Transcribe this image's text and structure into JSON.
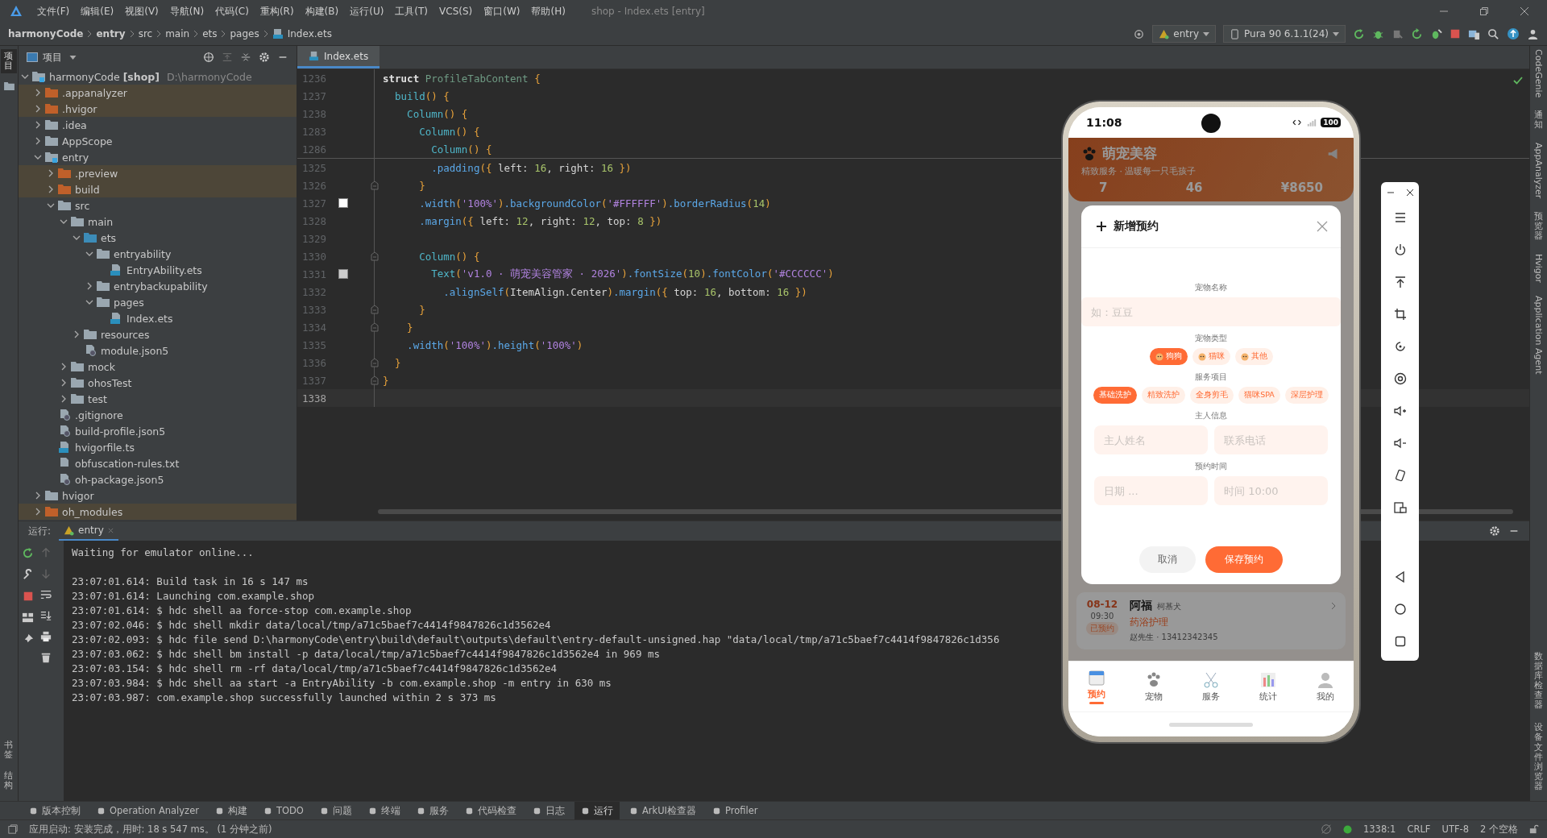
{
  "window": {
    "title": "shop - Index.ets [entry]",
    "menu": [
      "文件(F)",
      "编辑(E)",
      "视图(V)",
      "导航(N)",
      "代码(C)",
      "重构(R)",
      "构建(B)",
      "运行(U)",
      "工具(T)",
      "VCS(S)",
      "窗口(W)",
      "帮助(H)"
    ]
  },
  "breadcrumb": [
    {
      "label": "harmonyCode",
      "bold": true,
      "kind": "folder"
    },
    {
      "label": "entry",
      "bold": true,
      "kind": "folder"
    },
    {
      "label": "src",
      "bold": false,
      "kind": "folder"
    },
    {
      "label": "main",
      "bold": false,
      "kind": "folder"
    },
    {
      "label": "ets",
      "bold": false,
      "kind": "folder"
    },
    {
      "label": "pages",
      "bold": false,
      "kind": "folder"
    },
    {
      "label": "Index.ets",
      "bold": false,
      "kind": "file"
    }
  ],
  "toolbar": {
    "run_config": "entry",
    "device": "Pura 90 6.1.1(24)"
  },
  "left_strip": {
    "top": [
      {
        "label": "项目",
        "selected": true
      }
    ],
    "bottom": [
      {
        "label": "书签",
        "selected": false
      },
      {
        "label": "结构",
        "selected": false
      }
    ]
  },
  "right_strip": {
    "top": [
      {
        "label": "CodeGenie",
        "kind": "latin"
      },
      {
        "label": "通知",
        "kind": "cjk"
      },
      {
        "label": "AppAnalyzer",
        "kind": "latin"
      },
      {
        "label": "预览器",
        "kind": "cjk"
      },
      {
        "label": "Hvigor",
        "kind": "latin"
      },
      {
        "label": "Application Agent",
        "kind": "latin"
      }
    ],
    "bottom": [
      {
        "label": "数据库检查器",
        "kind": "cjk"
      },
      {
        "label": "设备文件浏览器",
        "kind": "cjk"
      }
    ]
  },
  "project_panel": {
    "title": "项目",
    "tree": [
      {
        "label": "harmonyCode **[shop]**",
        "path": "D:\\harmonyCode",
        "kind": "module",
        "expanded": true,
        "excluded": false,
        "children": [
          {
            "label": ".appanalyzer",
            "kind": "folder",
            "expanded": false,
            "excluded": true
          },
          {
            "label": ".hvigor",
            "kind": "folder",
            "expanded": false,
            "excluded": true
          },
          {
            "label": ".idea",
            "kind": "folder",
            "expanded": false,
            "excluded": false
          },
          {
            "label": "AppScope",
            "kind": "folder",
            "expanded": false,
            "excluded": false
          },
          {
            "label": "entry",
            "kind": "module",
            "expanded": true,
            "excluded": false,
            "children": [
              {
                "label": ".preview",
                "kind": "folder",
                "expanded": false,
                "excluded": true
              },
              {
                "label": "build",
                "kind": "folder",
                "expanded": false,
                "excluded": true
              },
              {
                "label": "src",
                "kind": "folder",
                "expanded": true,
                "excluded": false,
                "children": [
                  {
                    "label": "main",
                    "kind": "folder",
                    "expanded": true,
                    "excluded": false,
                    "children": [
                      {
                        "label": "ets",
                        "kind": "source",
                        "expanded": true,
                        "excluded": false,
                        "children": [
                          {
                            "label": "entryability",
                            "kind": "folder",
                            "expanded": true,
                            "excluded": false,
                            "children": [
                              {
                                "label": "EntryAbility.ets",
                                "kind": "ets",
                                "excluded": false
                              }
                            ]
                          },
                          {
                            "label": "entrybackupability",
                            "kind": "folder",
                            "expanded": false,
                            "excluded": false
                          },
                          {
                            "label": "pages",
                            "kind": "folder",
                            "expanded": true,
                            "excluded": false,
                            "children": [
                              {
                                "label": "Index.ets",
                                "kind": "ets",
                                "excluded": false
                              }
                            ]
                          }
                        ]
                      },
                      {
                        "label": "resources",
                        "kind": "folder",
                        "expanded": false,
                        "excluded": false
                      },
                      {
                        "label": "module.json5",
                        "kind": "json",
                        "excluded": false
                      }
                    ]
                  },
                  {
                    "label": "mock",
                    "kind": "folder",
                    "expanded": false,
                    "excluded": false
                  },
                  {
                    "label": "ohosTest",
                    "kind": "folder",
                    "expanded": false,
                    "excluded": false
                  },
                  {
                    "label": "test",
                    "kind": "folder",
                    "expanded": false,
                    "excluded": false
                  }
                ]
              },
              {
                "label": ".gitignore",
                "kind": "git",
                "excluded": false
              },
              {
                "label": "build-profile.json5",
                "kind": "json",
                "excluded": false
              },
              {
                "label": "hvigorfile.ts",
                "kind": "ts",
                "excluded": false
              },
              {
                "label": "obfuscation-rules.txt",
                "kind": "txt",
                "excluded": false
              },
              {
                "label": "oh-package.json5",
                "kind": "json",
                "excluded": false
              }
            ]
          },
          {
            "label": "hvigor",
            "kind": "folder",
            "expanded": false,
            "excluded": false
          },
          {
            "label": "oh_modules",
            "kind": "folder",
            "expanded": false,
            "excluded": true
          }
        ]
      }
    ]
  },
  "editor": {
    "tabs": [
      {
        "label": "Index.ets",
        "selected": true
      }
    ],
    "sticky_lines": [
      {
        "number": "1236",
        "tokens": [
          {
            "t": "struct ",
            "kind": "kw"
          },
          {
            "t": "ProfileTabContent ",
            "kind": "type"
          },
          {
            "t": "{",
            "kind": "p"
          }
        ]
      },
      {
        "number": "1237",
        "tokens": [
          {
            "t": "  build",
            "kind": "fn"
          },
          {
            "t": "() {",
            "kind": "p"
          }
        ]
      },
      {
        "number": "1238",
        "tokens": [
          {
            "t": "    Column",
            "kind": "fn"
          },
          {
            "t": "() {",
            "kind": "p"
          }
        ]
      },
      {
        "number": "1283",
        "tokens": [
          {
            "t": "      Column",
            "kind": "fn"
          },
          {
            "t": "() {",
            "kind": "p"
          }
        ]
      },
      {
        "number": "1286",
        "tokens": [
          {
            "t": "        Column",
            "kind": "fn"
          },
          {
            "t": "() {",
            "kind": "p"
          }
        ]
      }
    ],
    "lines": [
      {
        "number": "1325",
        "fold": false,
        "current": false,
        "tokens": [
          {
            "t": "        .padding",
            "kind": "m"
          },
          {
            "t": "({ ",
            "kind": "p"
          },
          {
            "t": "left: ",
            "kind": "x"
          },
          {
            "t": "16",
            "kind": "n"
          },
          {
            "t": ", ",
            "kind": "x"
          },
          {
            "t": "right: ",
            "kind": "x"
          },
          {
            "t": "16 ",
            "kind": "n"
          },
          {
            "t": "})",
            "kind": "p"
          }
        ]
      },
      {
        "number": "1326",
        "fold": true,
        "current": false,
        "tokens": [
          {
            "t": "      }",
            "kind": "p"
          }
        ]
      },
      {
        "number": "1327",
        "fold": false,
        "current": false,
        "color": "#ffffff",
        "tokens": [
          {
            "t": "      .width",
            "kind": "m"
          },
          {
            "t": "(",
            "kind": "p"
          },
          {
            "t": "'100%'",
            "kind": "s"
          },
          {
            "t": ")",
            "kind": "p"
          },
          {
            "t": ".backgroundColor",
            "kind": "m"
          },
          {
            "t": "(",
            "kind": "p"
          },
          {
            "t": "'#FFFFFF'",
            "kind": "s"
          },
          {
            "t": ")",
            "kind": "p"
          },
          {
            "t": ".borderRadius",
            "kind": "m"
          },
          {
            "t": "(",
            "kind": "p"
          },
          {
            "t": "14",
            "kind": "n"
          },
          {
            "t": ")",
            "kind": "p"
          }
        ]
      },
      {
        "number": "1328",
        "fold": false,
        "current": false,
        "tokens": [
          {
            "t": "      .margin",
            "kind": "m"
          },
          {
            "t": "({ ",
            "kind": "p"
          },
          {
            "t": "left: ",
            "kind": "x"
          },
          {
            "t": "12",
            "kind": "n"
          },
          {
            "t": ", right: ",
            "kind": "x"
          },
          {
            "t": "12",
            "kind": "n"
          },
          {
            "t": ", top: ",
            "kind": "x"
          },
          {
            "t": "8 ",
            "kind": "n"
          },
          {
            "t": "})",
            "kind": "p"
          }
        ]
      },
      {
        "number": "1329",
        "fold": false,
        "current": false
      },
      {
        "number": "1330",
        "fold": true,
        "current": false,
        "tokens": [
          {
            "t": "      Column",
            "kind": "fn"
          },
          {
            "t": "() {",
            "kind": "p"
          }
        ]
      },
      {
        "number": "1331",
        "fold": false,
        "current": false,
        "color": "#cccccc",
        "tokens": [
          {
            "t": "        Text",
            "kind": "fn"
          },
          {
            "t": "(",
            "kind": "p"
          },
          {
            "t": "'v1.0 · 萌宠美容管家 · 2026'",
            "kind": "s"
          },
          {
            "t": ")",
            "kind": "p"
          },
          {
            "t": ".fontSize",
            "kind": "m"
          },
          {
            "t": "(",
            "kind": "p"
          },
          {
            "t": "10",
            "kind": "n"
          },
          {
            "t": ")",
            "kind": "p"
          },
          {
            "t": ".fontColor",
            "kind": "m"
          },
          {
            "t": "(",
            "kind": "p"
          },
          {
            "t": "'#CCCCCC'",
            "kind": "s"
          },
          {
            "t": ")",
            "kind": "p"
          }
        ]
      },
      {
        "number": "1332",
        "fold": false,
        "current": false,
        "tokens": [
          {
            "t": "          .alignSelf",
            "kind": "m"
          },
          {
            "t": "(",
            "kind": "p"
          },
          {
            "t": "ItemAlign.Center",
            "kind": "x"
          },
          {
            "t": ")",
            "kind": "p"
          },
          {
            "t": ".margin",
            "kind": "m"
          },
          {
            "t": "({ ",
            "kind": "p"
          },
          {
            "t": "top: ",
            "kind": "x"
          },
          {
            "t": "16",
            "kind": "n"
          },
          {
            "t": ", bottom: ",
            "kind": "x"
          },
          {
            "t": "16 ",
            "kind": "n"
          },
          {
            "t": "})",
            "kind": "p"
          }
        ]
      },
      {
        "number": "1333",
        "fold": true,
        "current": false,
        "tokens": [
          {
            "t": "      }",
            "kind": "p"
          }
        ]
      },
      {
        "number": "1334",
        "fold": true,
        "current": false,
        "tokens": [
          {
            "t": "    }",
            "kind": "p"
          }
        ]
      },
      {
        "number": "1335",
        "fold": false,
        "current": false,
        "tokens": [
          {
            "t": "    .width",
            "kind": "m"
          },
          {
            "t": "(",
            "kind": "p"
          },
          {
            "t": "'100%'",
            "kind": "s"
          },
          {
            "t": ")",
            "kind": "p"
          },
          {
            "t": ".height",
            "kind": "m"
          },
          {
            "t": "(",
            "kind": "p"
          },
          {
            "t": "'100%'",
            "kind": "s"
          },
          {
            "t": ")",
            "kind": "p"
          }
        ]
      },
      {
        "number": "1336",
        "fold": true,
        "current": false,
        "tokens": [
          {
            "t": "  }",
            "kind": "p"
          }
        ]
      },
      {
        "number": "1337",
        "fold": true,
        "current": false,
        "tokens": [
          {
            "t": "}",
            "kind": "p"
          }
        ]
      },
      {
        "number": "1338",
        "fold": false,
        "current": true
      }
    ]
  },
  "run_panel": {
    "label": "运行:",
    "tabs": [
      {
        "label": "entry",
        "selected": true
      }
    ],
    "console": [
      {
        "text": "Waiting for emulator online...",
        "spaced": false
      },
      {
        "text": "23:07:01.614: Build task in 16 s 147 ms",
        "spaced": true
      },
      {
        "text": "23:07:01.614: Launching com.example.shop",
        "spaced": false
      },
      {
        "text": "23:07:01.614: $ hdc shell aa force-stop com.example.shop",
        "spaced": false
      },
      {
        "text": "23:07:02.046: $ hdc shell mkdir data/local/tmp/a71c5baef7c4414f9847826c1d3562e4",
        "spaced": false
      },
      {
        "text": "23:07:02.093: $ hdc file send D:\\harmonyCode\\entry\\build\\default\\outputs\\default\\entry-default-unsigned.hap \"data/local/tmp/a71c5baef7c4414f9847826c1d356",
        "spaced": false
      },
      {
        "text": "23:07:03.062: $ hdc shell bm install -p data/local/tmp/a71c5baef7c4414f9847826c1d3562e4 in 969 ms",
        "spaced": false
      },
      {
        "text": "23:07:03.154: $ hdc shell rm -rf data/local/tmp/a71c5baef7c4414f9847826c1d3562e4",
        "spaced": false
      },
      {
        "text": "23:07:03.984: $ hdc shell aa start -a EntryAbility -b com.example.shop -m entry in 630 ms",
        "spaced": false
      },
      {
        "text": "23:07:03.987: com.example.shop successfully launched within 2 s 373 ms",
        "spaced": false
      }
    ]
  },
  "tool_tabs": [
    {
      "label": "版本控制",
      "selected": false
    },
    {
      "label": "Operation Analyzer",
      "selected": false
    },
    {
      "label": "构建",
      "selected": false
    },
    {
      "label": "TODO",
      "selected": false
    },
    {
      "label": "问题",
      "selected": false
    },
    {
      "label": "终端",
      "selected": false
    },
    {
      "label": "服务",
      "selected": false
    },
    {
      "label": "代码检查",
      "selected": false
    },
    {
      "label": "日志",
      "selected": false
    },
    {
      "label": "运行",
      "selected": true
    },
    {
      "label": "ArkUI检查器",
      "selected": false
    },
    {
      "label": "Profiler",
      "selected": false
    }
  ],
  "status_bar": {
    "message": "应用启动: 安装完成，用时: 18 s 547 ms。 (1 分钟之前)",
    "position": "1338:1",
    "line_ending": "CRLF",
    "encoding": "UTF-8",
    "indent": "2 个空格"
  },
  "emulator": {
    "status_bar": {
      "time": "11:08",
      "battery": "100"
    },
    "app": {
      "title": "萌宠美容",
      "subtitle": "精致服务 · 温暖每一只毛孩子",
      "stats": [
        "7",
        "46",
        "¥8650"
      ],
      "appointment": {
        "date": "08-12",
        "time": "09:30",
        "status": "已预约",
        "pet": "阿福",
        "breed": "柯基犬",
        "service": "药浴护理",
        "owner": "赵先生 · 13412342345"
      },
      "tabs": [
        {
          "label": "预约",
          "selected": true
        },
        {
          "label": "宠物",
          "selected": false
        },
        {
          "label": "服务",
          "selected": false
        },
        {
          "label": "统计",
          "selected": false
        },
        {
          "label": "我的",
          "selected": false
        }
      ]
    },
    "dialog": {
      "title": "新增预约",
      "pet_name": {
        "label": "宠物名称",
        "placeholder": "如：豆豆"
      },
      "pet_type": {
        "label": "宠物类型",
        "options": [
          {
            "label": "狗狗",
            "selected": true
          },
          {
            "label": "猫咪",
            "selected": false
          },
          {
            "label": "其他",
            "selected": false
          }
        ]
      },
      "service": {
        "label": "服务项目",
        "options": [
          {
            "label": "基础洗护",
            "selected": true
          },
          {
            "label": "精致洗护",
            "selected": false
          },
          {
            "label": "全身剪毛",
            "selected": false
          },
          {
            "label": "猫咪SPA",
            "selected": false
          },
          {
            "label": "深层护理",
            "selected": false
          }
        ]
      },
      "owner": {
        "label": "主人信息",
        "fields": [
          {
            "placeholder": "主人姓名"
          },
          {
            "placeholder": "联系电话"
          }
        ]
      },
      "schedule": {
        "label": "预约时间",
        "fields": [
          {
            "placeholder": "日期 ..."
          },
          {
            "placeholder": "时间 10:00"
          }
        ]
      },
      "buttons": [
        {
          "label": "取消",
          "kind": "secondary"
        },
        {
          "label": "保存预约",
          "kind": "primary"
        }
      ]
    }
  }
}
